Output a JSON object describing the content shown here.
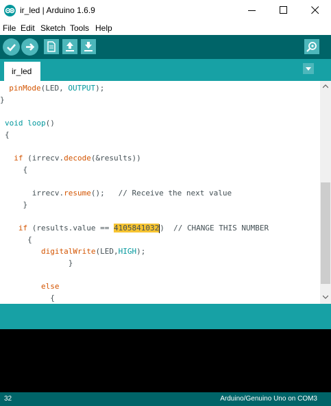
{
  "window": {
    "title": "ir_led | Arduino 1.6.9",
    "app_icon": "arduino-logo-icon"
  },
  "menu": {
    "items": [
      "File",
      "Edit",
      "Sketch",
      "Tools",
      "Help"
    ]
  },
  "toolbar": {
    "buttons": [
      "verify-icon",
      "upload-icon",
      "new-icon",
      "open-icon",
      "save-icon",
      "serial-monitor-icon"
    ]
  },
  "tabs": {
    "active": "ir_led"
  },
  "editor": {
    "lines": {
      "l0_a": "  ",
      "l0_b": "pinMode",
      "l0_c": "(LED, ",
      "l0_d": "OUTPUT",
      "l0_e": ");",
      "l1": "}",
      "l2_a": "void",
      "l2_b": " ",
      "l2_c": "loop",
      "l2_d": "()",
      "l3": "{",
      "l4_a": "  ",
      "l4_b": "if",
      "l4_c": " (irrecv.",
      "l4_d": "decode",
      "l4_e": "(&results))",
      "l5": "    {",
      "l6_a": "      irrecv.",
      "l6_b": "resume",
      "l6_c": "();   // Receive the next value",
      "l7": "    }",
      "l8_a": "   ",
      "l8_b": "if",
      "l8_c": " (",
      "l8_d": "results.value == ",
      "l8_e": "4105841032",
      "l8_f": ")  // CHANGE THIS NUMBER",
      "l9": "     {",
      "l10_a": "        ",
      "l10_b": "digitalWrite",
      "l10_c": "(LED,",
      "l10_d": "HIGH",
      "l10_e": ");",
      "l11": "              }",
      "l12_a": "        ",
      "l12_b": "else",
      "l13": "          {"
    }
  },
  "status": {
    "line_number": "32",
    "board": "Arduino/Genuino Uno on COM3"
  },
  "colors": {
    "toolbar_bg": "#006468",
    "tab_bg": "#17a1a5",
    "button_bg": "#4db7bb",
    "keyword": "#d35400",
    "function": "#00979c",
    "highlight": "#f7c431",
    "console_bg": "#000000"
  }
}
